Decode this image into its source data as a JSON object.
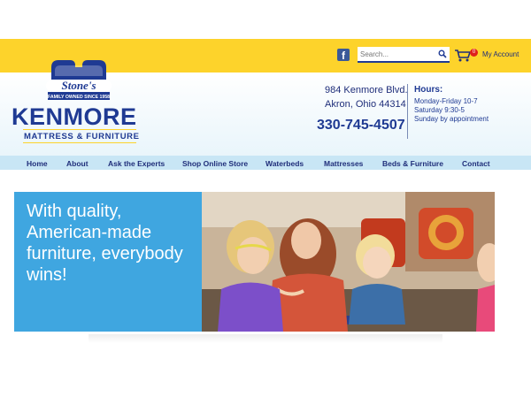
{
  "topbar": {
    "search_placeholder": "Search...",
    "cart_count": "0",
    "account_label": "My Account"
  },
  "logo": {
    "badge_script": "Stone's",
    "badge_tagline": "FAMILY OWNED SINCE 1958",
    "name": "KENMORE",
    "subtitle": "MATTRESS & FURNITURE"
  },
  "contact": {
    "address_line1": "984 Kenmore Blvd.",
    "address_line2": "Akron, Ohio 44314",
    "phone": "330-745-4507"
  },
  "hours": {
    "title": "Hours:",
    "lines": [
      "Monday-Friday 10-7",
      "Saturday 9:30-5",
      "Sunday by appointment"
    ]
  },
  "nav": {
    "items": [
      "Home",
      "About",
      "Ask the Experts",
      "Shop Online Store",
      "Waterbeds",
      "Mattresses",
      "Beds & Furniture",
      "Contact"
    ]
  },
  "hero": {
    "headline": "With quality, American-made furniture, everybody wins!"
  },
  "colors": {
    "topbar": "#fdd32b",
    "brand_blue": "#1f3a93",
    "nav_bg": "#c8e6f5",
    "hero_blue": "#3fa6e0"
  }
}
